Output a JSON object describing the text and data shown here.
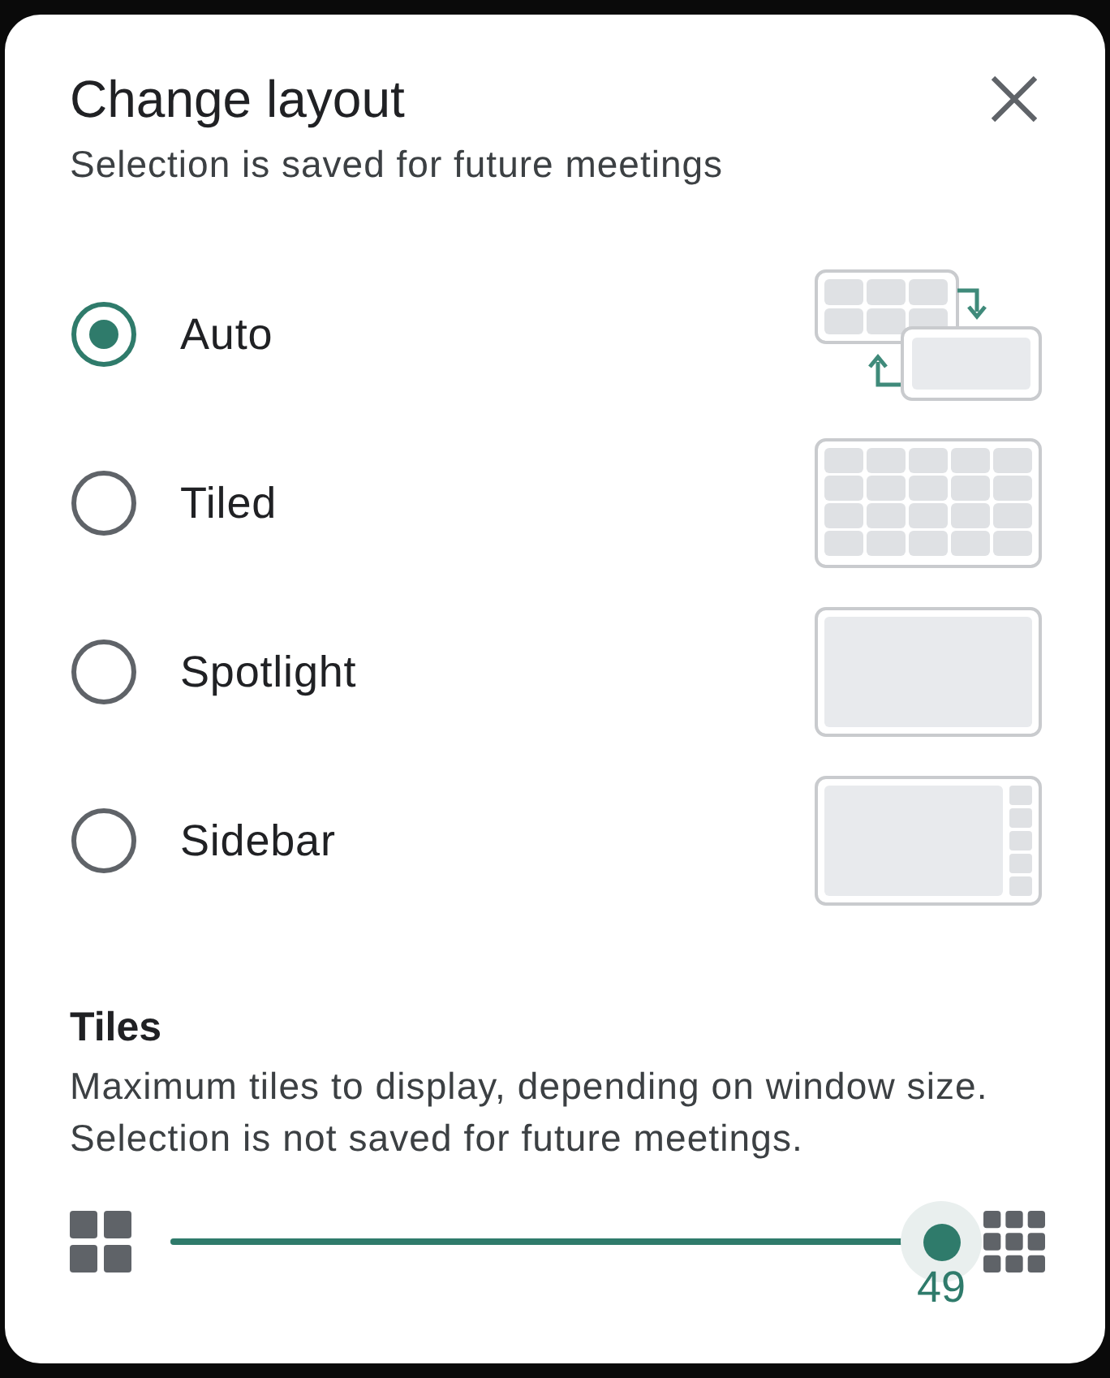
{
  "dialog": {
    "title": "Change layout",
    "subtitle": "Selection is saved for future meetings"
  },
  "layouts": [
    {
      "label": "Auto",
      "kind": "auto",
      "selected": true
    },
    {
      "label": "Tiled",
      "kind": "tiled",
      "selected": false
    },
    {
      "label": "Spotlight",
      "kind": "spotlight",
      "selected": false
    },
    {
      "label": "Sidebar",
      "kind": "sidebar",
      "selected": false
    }
  ],
  "tiles": {
    "heading": "Tiles",
    "description": "Maximum tiles to display, depending on window size. Selection is not saved for future meetings.",
    "slider": {
      "level": 1,
      "reading": "49"
    }
  }
}
